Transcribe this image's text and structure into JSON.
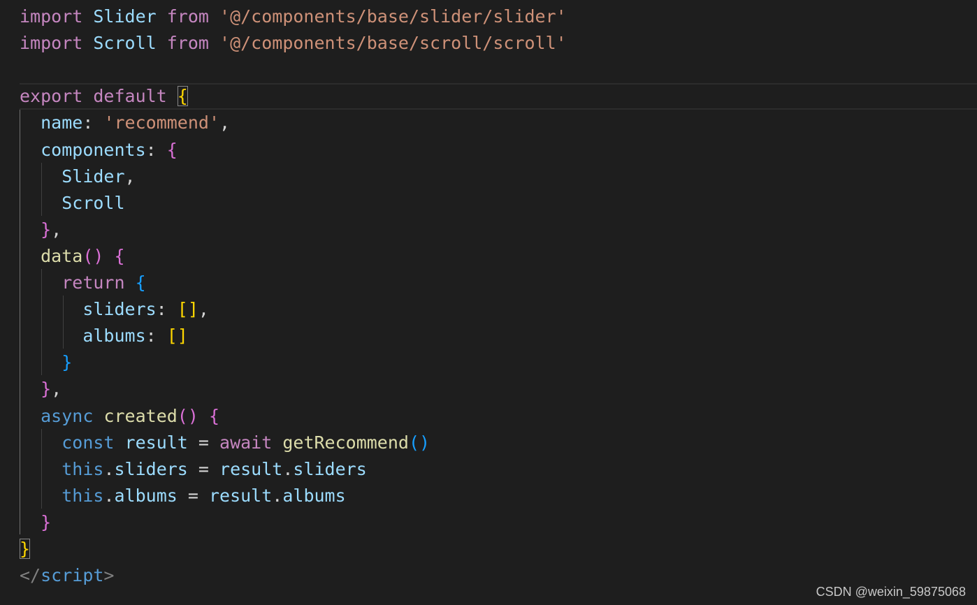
{
  "editor": {
    "background": "#1e1e1e",
    "lines": [
      [
        [
          "import ",
          "kw"
        ],
        [
          "Slider",
          "var"
        ],
        [
          " ",
          ""
        ],
        [
          "from",
          "kw"
        ],
        [
          " ",
          ""
        ],
        [
          "'@/components/base/slider/slider'",
          "str"
        ]
      ],
      [
        [
          "import ",
          "kw"
        ],
        [
          "Scroll",
          "var"
        ],
        [
          " ",
          ""
        ],
        [
          "from",
          "kw"
        ],
        [
          " ",
          ""
        ],
        [
          "'@/components/base/scroll/scroll'",
          "str"
        ]
      ],
      [],
      [
        [
          "export ",
          "kw"
        ],
        [
          "default",
          "kw"
        ],
        [
          " ",
          ""
        ],
        [
          "{",
          "b-gold box"
        ]
      ],
      [
        [
          "  ",
          ""
        ],
        [
          "name",
          "var"
        ],
        [
          ": ",
          "op"
        ],
        [
          "'recommend'",
          "str"
        ],
        [
          ",",
          "op"
        ]
      ],
      [
        [
          "  ",
          ""
        ],
        [
          "components",
          "var"
        ],
        [
          ": ",
          "op"
        ],
        [
          "{",
          "b-pink"
        ]
      ],
      [
        [
          "    ",
          ""
        ],
        [
          "Slider",
          "var"
        ],
        [
          ",",
          "op"
        ]
      ],
      [
        [
          "    ",
          ""
        ],
        [
          "Scroll",
          "var"
        ]
      ],
      [
        [
          "  ",
          ""
        ],
        [
          "}",
          "b-pink"
        ],
        [
          ",",
          "op"
        ]
      ],
      [
        [
          "  ",
          ""
        ],
        [
          "data",
          "fn"
        ],
        [
          "()",
          "b-pink"
        ],
        [
          " ",
          ""
        ],
        [
          "{",
          "b-pink"
        ]
      ],
      [
        [
          "    ",
          ""
        ],
        [
          "return",
          "kw"
        ],
        [
          " ",
          ""
        ],
        [
          "{",
          "b-blue"
        ]
      ],
      [
        [
          "      ",
          ""
        ],
        [
          "sliders",
          "var"
        ],
        [
          ": ",
          "op"
        ],
        [
          "[]",
          "b-gold"
        ],
        [
          ",",
          "op"
        ]
      ],
      [
        [
          "      ",
          ""
        ],
        [
          "albums",
          "var"
        ],
        [
          ": ",
          "op"
        ],
        [
          "[]",
          "b-gold"
        ]
      ],
      [
        [
          "    ",
          ""
        ],
        [
          "}",
          "b-blue"
        ]
      ],
      [
        [
          "  ",
          ""
        ],
        [
          "}",
          "b-pink"
        ],
        [
          ",",
          "op"
        ]
      ],
      [
        [
          "  ",
          ""
        ],
        [
          "async",
          "kw2"
        ],
        [
          " ",
          ""
        ],
        [
          "created",
          "fn"
        ],
        [
          "()",
          "b-pink"
        ],
        [
          " ",
          ""
        ],
        [
          "{",
          "b-pink"
        ]
      ],
      [
        [
          "    ",
          ""
        ],
        [
          "const",
          "kw2"
        ],
        [
          " ",
          ""
        ],
        [
          "result",
          "var"
        ],
        [
          " = ",
          "op"
        ],
        [
          "await",
          "kw"
        ],
        [
          " ",
          ""
        ],
        [
          "getRecommend",
          "fn"
        ],
        [
          "()",
          "b-blue"
        ]
      ],
      [
        [
          "    ",
          ""
        ],
        [
          "this",
          "kw2"
        ],
        [
          ".",
          "op"
        ],
        [
          "sliders",
          "var"
        ],
        [
          " = ",
          "op"
        ],
        [
          "result",
          "var"
        ],
        [
          ".",
          "op"
        ],
        [
          "sliders",
          "var"
        ]
      ],
      [
        [
          "    ",
          ""
        ],
        [
          "this",
          "kw2"
        ],
        [
          ".",
          "op"
        ],
        [
          "albums",
          "var"
        ],
        [
          " = ",
          "op"
        ],
        [
          "result",
          "var"
        ],
        [
          ".",
          "op"
        ],
        [
          "albums",
          "var"
        ]
      ],
      [
        [
          "  ",
          ""
        ],
        [
          "}",
          "b-pink"
        ]
      ],
      [
        [
          "}",
          "b-gold box"
        ]
      ],
      [
        [
          "</",
          "tag"
        ],
        [
          "script",
          "kw2"
        ],
        [
          ">",
          "tag"
        ]
      ]
    ]
  },
  "watermark": {
    "text": "CSDN @weixin_59875068"
  }
}
